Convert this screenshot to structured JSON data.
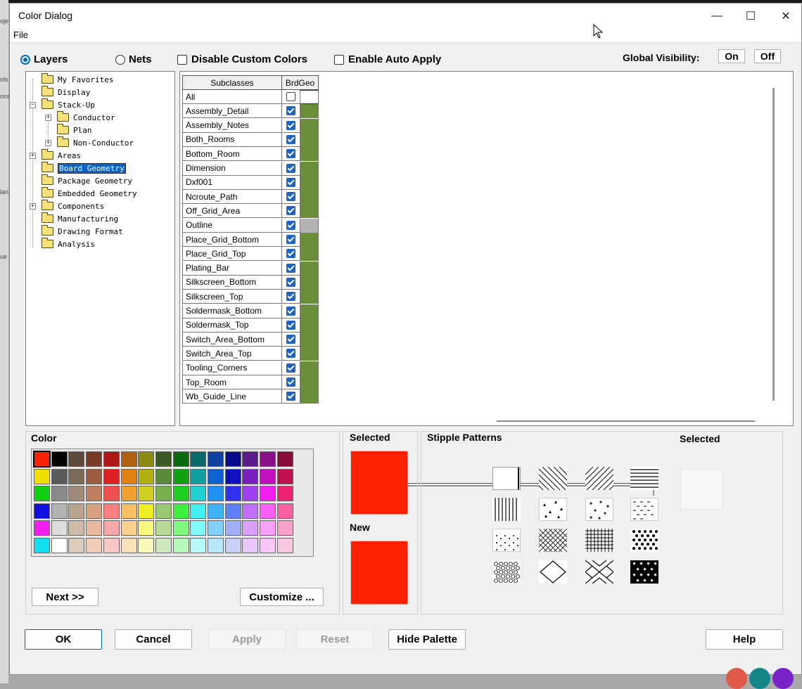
{
  "background": {
    "left_strip_labels": [
      "oje",
      "ols",
      "ons",
      "lan",
      "ue"
    ]
  },
  "window": {
    "title": "Color Dialog",
    "controls": {
      "minimize": "—",
      "maximize": "☐",
      "close": "✕"
    },
    "menu": {
      "file": "File"
    }
  },
  "mode": {
    "layers_label": "Layers",
    "nets_label": "Nets",
    "selected": "Layers"
  },
  "options": {
    "disable_custom_colors": "Disable Custom Colors",
    "enable_auto_apply": "Enable Auto Apply"
  },
  "global_visibility": {
    "label": "Global Visibility:",
    "on": "On",
    "off": "Off"
  },
  "tree": {
    "items": [
      {
        "label": "My Favorites",
        "level": 0,
        "expander": ""
      },
      {
        "label": "Display",
        "level": 0,
        "expander": ""
      },
      {
        "label": "Stack-Up",
        "level": 0,
        "expander": "−"
      },
      {
        "label": "Conductor",
        "level": 1,
        "expander": "+"
      },
      {
        "label": "Plan",
        "level": 1,
        "expander": ""
      },
      {
        "label": "Non-Conductor",
        "level": 1,
        "expander": "+"
      },
      {
        "label": "Areas",
        "level": 0,
        "expander": "+"
      },
      {
        "label": "Board Geometry",
        "level": 0,
        "expander": "",
        "selected": true
      },
      {
        "label": "Package Geometry",
        "level": 0,
        "expander": ""
      },
      {
        "label": "Embedded Geometry",
        "level": 0,
        "expander": ""
      },
      {
        "label": "Components",
        "level": 0,
        "expander": "+"
      },
      {
        "label": "Manufacturing",
        "level": 0,
        "expander": ""
      },
      {
        "label": "Drawing Format",
        "level": 0,
        "expander": ""
      },
      {
        "label": "Analysis",
        "level": 0,
        "expander": ""
      }
    ]
  },
  "grid": {
    "headers": {
      "subclasses": "Subclasses",
      "column": "BrdGeo"
    },
    "swatch_color": "#6b8e3a",
    "highlight_color": "#b4b4b4",
    "rows": [
      {
        "name": "All",
        "checked": false,
        "swatch": "none"
      },
      {
        "name": "Assembly_Detail",
        "checked": true,
        "swatch": "green"
      },
      {
        "name": "Assembly_Notes",
        "checked": true,
        "swatch": "green"
      },
      {
        "name": "Both_Rooms",
        "checked": true,
        "swatch": "green"
      },
      {
        "name": "Bottom_Room",
        "checked": true,
        "swatch": "green"
      },
      {
        "name": "Dimension",
        "checked": true,
        "swatch": "green"
      },
      {
        "name": "Dxf001",
        "checked": true,
        "swatch": "green"
      },
      {
        "name": "Ncroute_Path",
        "checked": true,
        "swatch": "green"
      },
      {
        "name": "Off_Grid_Area",
        "checked": true,
        "swatch": "green"
      },
      {
        "name": "Outline",
        "checked": true,
        "swatch": "gray"
      },
      {
        "name": "Place_Grid_Bottom",
        "checked": true,
        "swatch": "green"
      },
      {
        "name": "Place_Grid_Top",
        "checked": true,
        "swatch": "green"
      },
      {
        "name": "Plating_Bar",
        "checked": true,
        "swatch": "green"
      },
      {
        "name": "Silkscreen_Bottom",
        "checked": true,
        "swatch": "green"
      },
      {
        "name": "Silkscreen_Top",
        "checked": true,
        "swatch": "green"
      },
      {
        "name": "Soldermask_Bottom",
        "checked": true,
        "swatch": "green"
      },
      {
        "name": "Soldermask_Top",
        "checked": true,
        "swatch": "green"
      },
      {
        "name": "Switch_Area_Bottom",
        "checked": true,
        "swatch": "green"
      },
      {
        "name": "Switch_Area_Top",
        "checked": true,
        "swatch": "green"
      },
      {
        "name": "Tooling_Corners",
        "checked": true,
        "swatch": "green"
      },
      {
        "name": "Top_Room",
        "checked": true,
        "swatch": "green"
      },
      {
        "name": "Wb_Guide_Line",
        "checked": true,
        "swatch": "green"
      }
    ]
  },
  "color_panel": {
    "label": "Color",
    "palette": [
      [
        "#ff2200",
        "#000000",
        "#5c4a3c",
        "#7a3a28",
        "#b01818",
        "#b06010",
        "#8a8a10",
        "#3c5a28",
        "#0a6a10",
        "#0a6a6a",
        "#1040a0",
        "#0a0a8a",
        "#5a1a8a",
        "#8a108a",
        "#8a0a3a"
      ],
      [
        "#f0e000",
        "#5a5a5a",
        "#7a6a5a",
        "#a05a40",
        "#e02020",
        "#e08010",
        "#b0b010",
        "#5a8a3a",
        "#10a010",
        "#10a0a0",
        "#1060d0",
        "#1010c0",
        "#7a20c0",
        "#c010c0",
        "#c01050"
      ],
      [
        "#10d010",
        "#8a8a8a",
        "#a08a7a",
        "#c08060",
        "#f05050",
        "#f0a030",
        "#d0d020",
        "#7ab050",
        "#20d020",
        "#20d0d0",
        "#2090f0",
        "#3030f0",
        "#a040f0",
        "#f020f0",
        "#f02070"
      ],
      [
        "#1010e0",
        "#b4b4b4",
        "#b8a490",
        "#d8a080",
        "#f88080",
        "#f8c060",
        "#f0f020",
        "#9ac870",
        "#40f040",
        "#40f0f0",
        "#40b0f8",
        "#6080f8",
        "#c070f8",
        "#f860f8",
        "#f860a0"
      ],
      [
        "#f020f0",
        "#dcdcdc",
        "#ccbca8",
        "#e8b8a0",
        "#f8a8a8",
        "#f8d090",
        "#f8f880",
        "#b8dc98",
        "#80f880",
        "#80f8f8",
        "#80d0f8",
        "#a0b0f8",
        "#d8a0f8",
        "#f8a0f8",
        "#f8a0c8"
      ],
      [
        "#10e0f0",
        "#ffffff",
        "#d8ccbc",
        "#f0ccb8",
        "#f8c8c8",
        "#f8e0b8",
        "#f8f8b8",
        "#d0e8c0",
        "#b8f8b8",
        "#b8f8f8",
        "#b8e8f8",
        "#c8d0f8",
        "#e8c8f8",
        "#f8c8f8",
        "#f8c8e0"
      ]
    ],
    "selected_index": 0,
    "next_button": "Next >>",
    "customize_button": "Customize ..."
  },
  "selected_panel": {
    "selected_label": "Selected",
    "new_label": "New",
    "selected_color": "#ff2200",
    "new_color": "#ff2200"
  },
  "stipple_panel": {
    "label": "Stipple Patterns",
    "selected_label": "Selected"
  },
  "buttons": {
    "ok": "OK",
    "cancel": "Cancel",
    "apply": "Apply",
    "reset": "Reset",
    "hide_palette": "Hide Palette",
    "help": "Help"
  },
  "taskbar_bubbles": [
    "#e05a4a",
    "#14868a",
    "#7a24c8"
  ]
}
